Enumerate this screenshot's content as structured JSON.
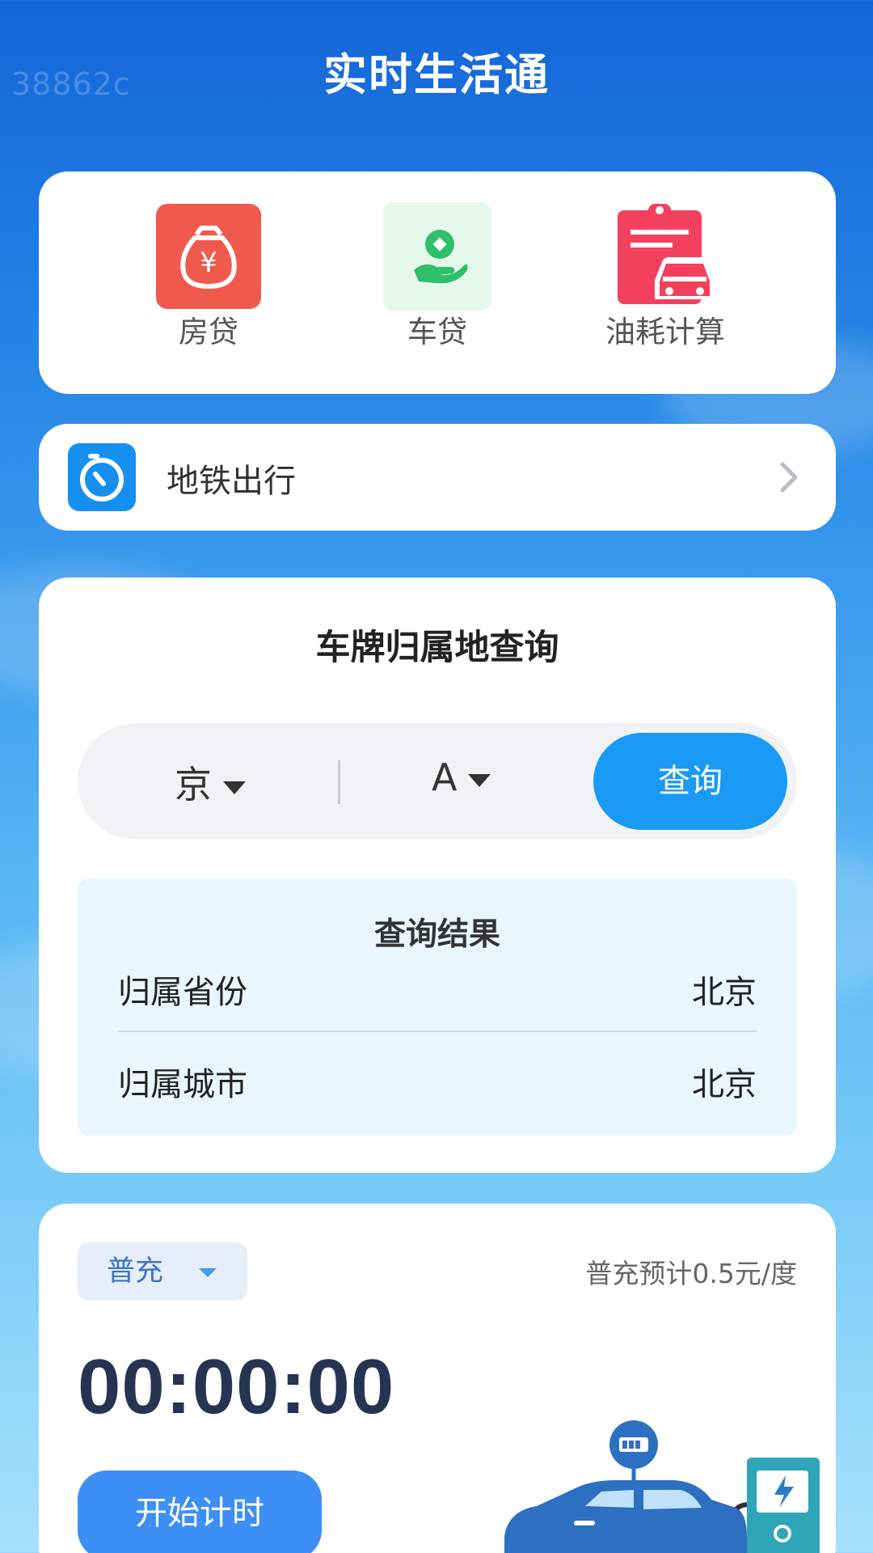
{
  "header": {
    "watermark": "38862c",
    "title": "实时生活通"
  },
  "tools": [
    {
      "label": "房贷",
      "icon": "money-bag-icon"
    },
    {
      "label": "车贷",
      "icon": "hand-coin-icon"
    },
    {
      "label": "油耗计算",
      "icon": "fuel-calc-icon"
    }
  ],
  "subway": {
    "label": "地铁出行",
    "icon": "subway-icon"
  },
  "plate": {
    "title": "车牌归属地查询",
    "province": "京",
    "letter": "A",
    "query_label": "查询",
    "result_title": "查询结果",
    "rows": [
      {
        "key": "归属省份",
        "value": "北京"
      },
      {
        "key": "归属城市",
        "value": "北京"
      }
    ]
  },
  "charge": {
    "mode": "普充",
    "price_note": "普充预计0.5元/度",
    "timer": "00:00:00",
    "start_label": "开始计时"
  },
  "colors": {
    "accent": "#1a9af5",
    "start_button": "#3d8ff5",
    "subway_icon": "#1590f0",
    "loan_red": "#f05a4c",
    "fuel_red": "#f4405f"
  }
}
